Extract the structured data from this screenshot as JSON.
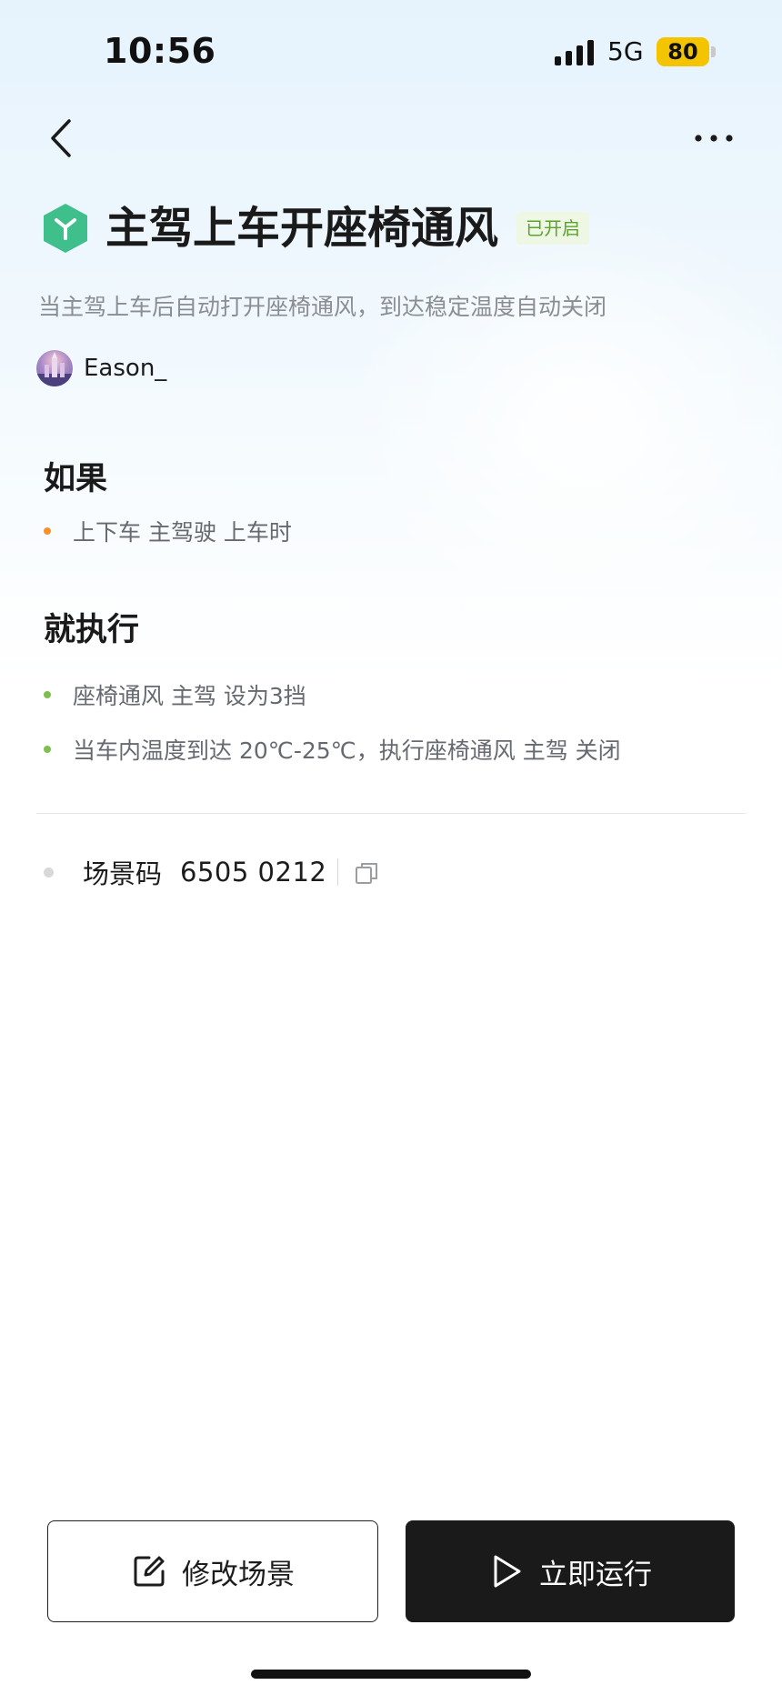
{
  "status_bar": {
    "time": "10:56",
    "network": "5G",
    "battery": "80"
  },
  "nav": {
    "back_icon": "chevron-left-icon",
    "more_icon": "more-horizontal-icon"
  },
  "scene": {
    "icon": "scene-hexagon-icon",
    "title": "主驾上车开座椅通风",
    "status": "已开启",
    "description": "当主驾上车后自动打开座椅通风，到达稳定温度自动关闭",
    "author": "Eason_"
  },
  "if_section": {
    "heading": "如果",
    "items": [
      "上下车 主驾驶 上车时"
    ]
  },
  "then_section": {
    "heading": "就执行",
    "items": [
      "座椅通风 主驾 设为3挡",
      "当车内温度到达 20℃-25℃，执行座椅通风 主驾 关闭"
    ]
  },
  "scene_code": {
    "label": "场景码",
    "value": "6505 0212",
    "copy_icon": "copy-icon"
  },
  "actions": {
    "edit_label": "修改场景",
    "run_label": "立即运行"
  },
  "colors": {
    "accent_green": "#3fbf8c",
    "status_green": "#5ba22f",
    "if_dot": "#f5922b",
    "then_dot": "#7fbf4d",
    "battery": "#f5c400"
  }
}
